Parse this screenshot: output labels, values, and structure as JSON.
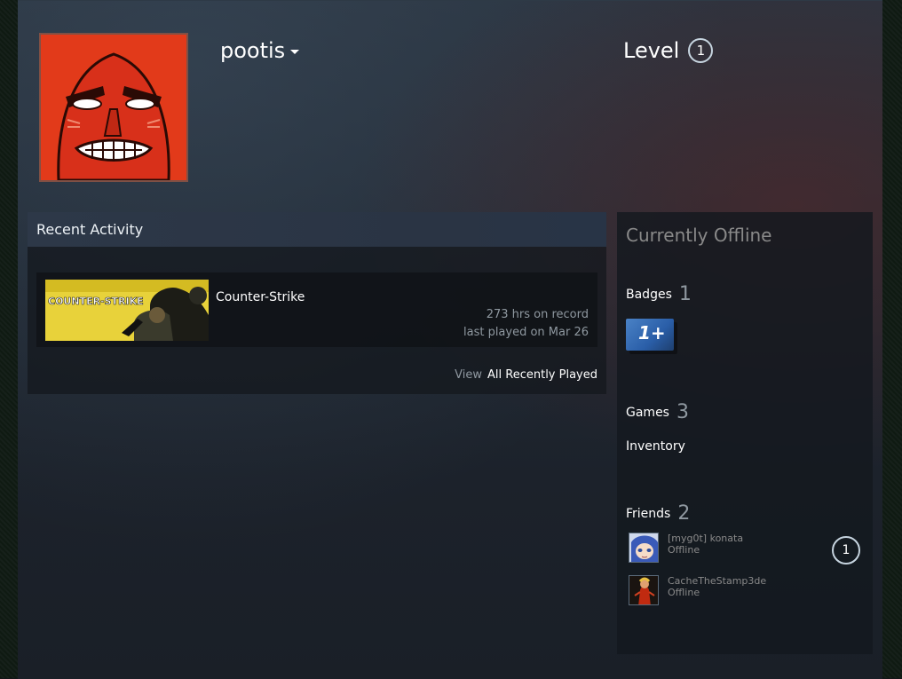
{
  "profile": {
    "persona_name": "pootis",
    "level_label": "Level",
    "level_value": "1"
  },
  "recent_activity": {
    "header": "Recent Activity",
    "games": [
      {
        "name": "Counter-Strike",
        "capsule_text": "COUNTER-STRIKE",
        "hours": "273 hrs on record",
        "last_played": "last played on Mar 26"
      }
    ],
    "view_label": "View",
    "view_link": "All Recently Played"
  },
  "sidebar": {
    "status": "Currently Offline",
    "badges_label": "Badges",
    "badges_count": "1",
    "badge_icon_text": "1+",
    "games_label": "Games",
    "games_count": "3",
    "inventory_label": "Inventory",
    "friends_label": "Friends",
    "friends_count": "2",
    "friends": [
      {
        "name": "[myg0t] konata",
        "status": "Offline",
        "level": "1"
      },
      {
        "name": "CacheTheStamp3de",
        "status": "Offline"
      }
    ]
  },
  "colors": {
    "page_bg": "#1c222b",
    "panel_bg": "#14181e",
    "header_bg": "#2d3848",
    "text_primary": "#ffffff",
    "text_muted": "#8f98a0",
    "offline_gray": "#898989",
    "avatar_red": "#e23a1a",
    "capsule_yellow": "#e8d23a",
    "badge_blue": "#4a82c6"
  }
}
